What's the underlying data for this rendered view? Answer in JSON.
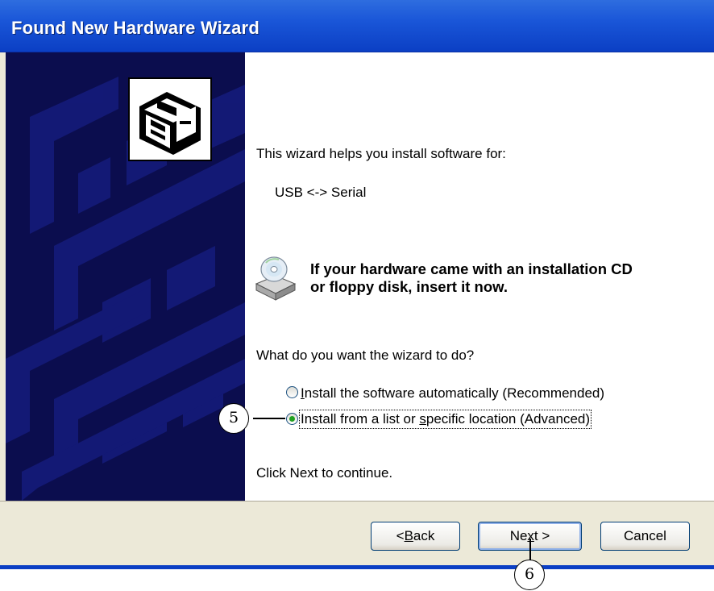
{
  "window": {
    "title": "Found New Hardware Wizard"
  },
  "intro": {
    "line1": "This wizard helps you install software for:",
    "device": "USB <-> Serial"
  },
  "notice": {
    "line1": "If your hardware came with an installation CD",
    "line2": "or floppy disk, insert it now."
  },
  "question": "What do you want the wizard to do?",
  "options": [
    {
      "before": "",
      "accel": "I",
      "after": "nstall the software automatically (Recommended)",
      "checked": false
    },
    {
      "before": "Install from a list or ",
      "accel": "s",
      "after": "pecific location (Advanced)",
      "checked": true
    }
  ],
  "footer_hint": "Click Next to continue.",
  "buttons": {
    "back": {
      "prefix": "< ",
      "accel": "B",
      "rest": "ack"
    },
    "next": {
      "prefix": "Ne",
      "accel": "x",
      "rest": "t >"
    },
    "cancel": "Cancel"
  },
  "callouts": {
    "radio_advanced": "5",
    "next_button": "6"
  },
  "colors": {
    "titlebar": "#1a56d8",
    "banner": "#0b0d4e",
    "dialog_bg": "#ece9d8",
    "radio_dot": "#21a121"
  }
}
